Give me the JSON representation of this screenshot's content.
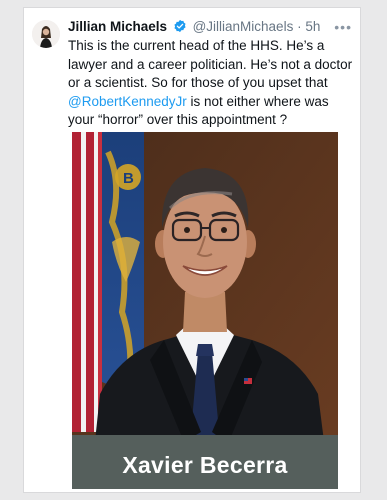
{
  "tweet": {
    "author_name": "Jillian Michaels",
    "handle": "@JillianMichaels",
    "separator": "·",
    "time": "5h",
    "more_icon": "more-horizontal-icon",
    "verified_icon": "verified-badge-icon",
    "text_line1": "This is the current head of the HHS.  He’s a",
    "text_line2": "lawyer and a career politician. He’s not a doctor",
    "text_line3": "or a scientist. So for those of you upset that",
    "mention": "@RobertKennedyJr",
    "text_line4_rest": " is not either where was",
    "text_line5": "your “horror” over this appointment ?"
  },
  "media": {
    "caption": "Xavier Becerra",
    "seal_letter": "B"
  },
  "colors": {
    "accent": "#1d9bf0",
    "text": "#0f1419",
    "muted": "#687684",
    "caption_bar": "#555f5c"
  }
}
